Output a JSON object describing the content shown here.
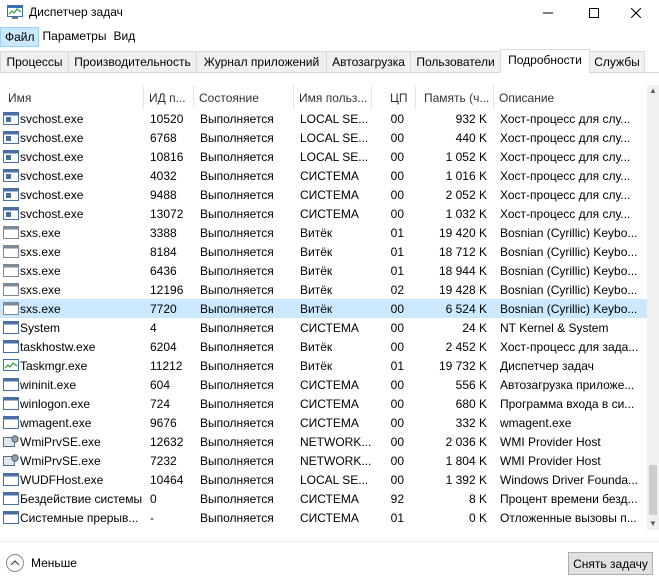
{
  "window": {
    "title": "Диспетчер задач",
    "icon": "task-manager-icon"
  },
  "menu": [
    "Файл",
    "Параметры",
    "Вид"
  ],
  "tabs": [
    {
      "label": "Процессы"
    },
    {
      "label": "Производительность"
    },
    {
      "label": "Журнал приложений"
    },
    {
      "label": "Автозагрузка"
    },
    {
      "label": "Пользователи"
    },
    {
      "label": "Подробности",
      "active": true
    },
    {
      "label": "Службы"
    }
  ],
  "columns": [
    "Имя",
    "ИД п...",
    "Состояние",
    "Имя польз...",
    "ЦП",
    "Память (ч...",
    "Описание"
  ],
  "rows": [
    {
      "name": "svchost.exe",
      "pid": "10520",
      "status": "Выполняется",
      "user": "LOCAL SE...",
      "cpu": "00",
      "mem": "932 K",
      "desc": "Хост-процесс для слу...",
      "icon": "svchost"
    },
    {
      "name": "svchost.exe",
      "pid": "6768",
      "status": "Выполняется",
      "user": "LOCAL SE...",
      "cpu": "00",
      "mem": "440 K",
      "desc": "Хост-процесс для слу...",
      "icon": "svchost"
    },
    {
      "name": "svchost.exe",
      "pid": "10816",
      "status": "Выполняется",
      "user": "LOCAL SE...",
      "cpu": "00",
      "mem": "1 052 K",
      "desc": "Хост-процесс для слу...",
      "icon": "svchost"
    },
    {
      "name": "svchost.exe",
      "pid": "4032",
      "status": "Выполняется",
      "user": "СИСТЕМА",
      "cpu": "00",
      "mem": "1 016 K",
      "desc": "Хост-процесс для слу...",
      "icon": "svchost"
    },
    {
      "name": "svchost.exe",
      "pid": "9488",
      "status": "Выполняется",
      "user": "СИСТЕМА",
      "cpu": "00",
      "mem": "2 052 K",
      "desc": "Хост-процесс для слу...",
      "icon": "svchost"
    },
    {
      "name": "svchost.exe",
      "pid": "13072",
      "status": "Выполняется",
      "user": "СИСТЕМА",
      "cpu": "00",
      "mem": "1 032 K",
      "desc": "Хост-процесс для слу...",
      "icon": "svchost"
    },
    {
      "name": "sxs.exe",
      "pid": "3388",
      "status": "Выполняется",
      "user": "Витёк",
      "cpu": "01",
      "mem": "19 420 K",
      "desc": "Bosnian (Cyrillic) Keybo...",
      "icon": "sxs"
    },
    {
      "name": "sxs.exe",
      "pid": "8184",
      "status": "Выполняется",
      "user": "Витёк",
      "cpu": "01",
      "mem": "18 712 K",
      "desc": "Bosnian (Cyrillic) Keybo...",
      "icon": "sxs"
    },
    {
      "name": "sxs.exe",
      "pid": "6436",
      "status": "Выполняется",
      "user": "Витёк",
      "cpu": "01",
      "mem": "18 944 K",
      "desc": "Bosnian (Cyrillic) Keybo...",
      "icon": "sxs"
    },
    {
      "name": "sxs.exe",
      "pid": "12196",
      "status": "Выполняется",
      "user": "Витёк",
      "cpu": "02",
      "mem": "19 428 K",
      "desc": "Bosnian (Cyrillic) Keybo...",
      "icon": "sxs"
    },
    {
      "name": "sxs.exe",
      "pid": "7720",
      "status": "Выполняется",
      "user": "Витёк",
      "cpu": "00",
      "mem": "6 524 K",
      "desc": "Bosnian (Cyrillic) Keybo...",
      "icon": "sxs",
      "selected": true
    },
    {
      "name": "System",
      "pid": "4",
      "status": "Выполняется",
      "user": "СИСТЕМА",
      "cpu": "00",
      "mem": "24 K",
      "desc": "NT Kernel & System",
      "icon": "system"
    },
    {
      "name": "taskhostw.exe",
      "pid": "6204",
      "status": "Выполняется",
      "user": "Витёк",
      "cpu": "00",
      "mem": "2 452 K",
      "desc": "Хост-процесс для зада...",
      "icon": "generic"
    },
    {
      "name": "Taskmgr.exe",
      "pid": "11212",
      "status": "Выполняется",
      "user": "Витёк",
      "cpu": "01",
      "mem": "19 732 K",
      "desc": "Диспетчер задач",
      "icon": "taskmgr"
    },
    {
      "name": "wininit.exe",
      "pid": "604",
      "status": "Выполняется",
      "user": "СИСТЕМА",
      "cpu": "00",
      "mem": "556 K",
      "desc": "Автозагрузка приложе...",
      "icon": "generic"
    },
    {
      "name": "winlogon.exe",
      "pid": "724",
      "status": "Выполняется",
      "user": "СИСТЕМА",
      "cpu": "00",
      "mem": "680 K",
      "desc": "Программа входа в си...",
      "icon": "generic"
    },
    {
      "name": "wmagent.exe",
      "pid": "9676",
      "status": "Выполняется",
      "user": "СИСТЕМА",
      "cpu": "00",
      "mem": "332 K",
      "desc": "wmagent.exe",
      "icon": "generic"
    },
    {
      "name": "WmiPrvSE.exe",
      "pid": "12632",
      "status": "Выполняется",
      "user": "NETWORK...",
      "cpu": "00",
      "mem": "2 036 K",
      "desc": "WMI Provider Host",
      "icon": "wmi"
    },
    {
      "name": "WmiPrvSE.exe",
      "pid": "7232",
      "status": "Выполняется",
      "user": "NETWORK...",
      "cpu": "00",
      "mem": "1 804 K",
      "desc": "WMI Provider Host",
      "icon": "wmi"
    },
    {
      "name": "WUDFHost.exe",
      "pid": "10464",
      "status": "Выполняется",
      "user": "LOCAL SE...",
      "cpu": "00",
      "mem": "1 392 K",
      "desc": "Windows Driver Founda...",
      "icon": "generic"
    },
    {
      "name": "Бездействие системы",
      "pid": "0",
      "status": "Выполняется",
      "user": "СИСТЕМА",
      "cpu": "92",
      "mem": "8 K",
      "desc": "Процент времени безд...",
      "icon": "idle"
    },
    {
      "name": "Системные прерыв...",
      "pid": "-",
      "status": "Выполняется",
      "user": "СИСТЕМА",
      "cpu": "01",
      "mem": "0 K",
      "desc": "Отложенные вызовы п...",
      "icon": "generic"
    }
  ],
  "footer": {
    "less_label": "Меньше",
    "end_task_label": "Снять задачу"
  },
  "colors": {
    "selection": "#cce8ff",
    "menu_active": "#cce8ff",
    "icon_blue": "#2b6cb0"
  }
}
